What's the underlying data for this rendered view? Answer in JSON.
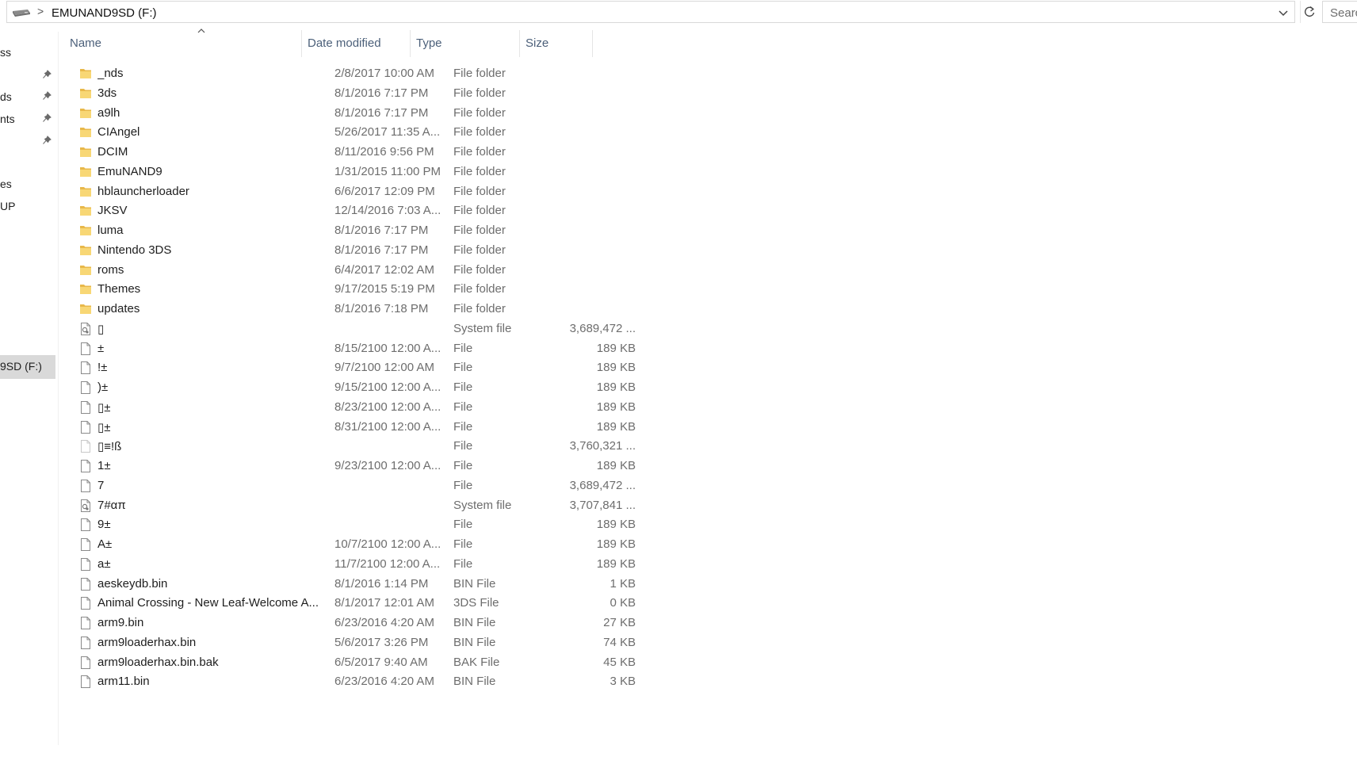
{
  "address_bar": {
    "drive_icon": "drive-icon",
    "separator": ">",
    "location": "EMUNAND9SD (F:)",
    "dropdown_icon": "chevron-down-icon",
    "refresh_icon": "refresh-icon"
  },
  "search": {
    "label": "Search"
  },
  "nav": {
    "items": [
      {
        "label": "ss",
        "pinned": false
      },
      {
        "label": "",
        "pinned": true
      },
      {
        "label": "ds",
        "pinned": true
      },
      {
        "label": "nts",
        "pinned": true
      },
      {
        "label": "",
        "pinned": true
      },
      {
        "label": "es",
        "pinned": false
      },
      {
        "label": "UP",
        "pinned": false
      }
    ],
    "selected": {
      "label": "9SD (F:)"
    }
  },
  "columns": {
    "name": "Name",
    "date_modified": "Date modified",
    "type": "Type",
    "size": "Size",
    "sort_icon": "sort-ascending-icon"
  },
  "files": [
    {
      "name": "_nds",
      "date": "2/8/2017 10:00 AM",
      "type": "File folder",
      "size": "",
      "icon": "folder"
    },
    {
      "name": "3ds",
      "date": "8/1/2016 7:17 PM",
      "type": "File folder",
      "size": "",
      "icon": "folder"
    },
    {
      "name": "a9lh",
      "date": "8/1/2016 7:17 PM",
      "type": "File folder",
      "size": "",
      "icon": "folder"
    },
    {
      "name": "CIAngel",
      "date": "5/26/2017 11:35 A...",
      "type": "File folder",
      "size": "",
      "icon": "folder"
    },
    {
      "name": "DCIM",
      "date": "8/11/2016 9:56 PM",
      "type": "File folder",
      "size": "",
      "icon": "folder"
    },
    {
      "name": "EmuNAND9",
      "date": "1/31/2015 11:00 PM",
      "type": "File folder",
      "size": "",
      "icon": "folder"
    },
    {
      "name": "hblauncherloader",
      "date": "6/6/2017 12:09 PM",
      "type": "File folder",
      "size": "",
      "icon": "folder"
    },
    {
      "name": "JKSV",
      "date": "12/14/2016 7:03 A...",
      "type": "File folder",
      "size": "",
      "icon": "folder"
    },
    {
      "name": "luma",
      "date": "8/1/2016 7:17 PM",
      "type": "File folder",
      "size": "",
      "icon": "folder"
    },
    {
      "name": "Nintendo 3DS",
      "date": "8/1/2016 7:17 PM",
      "type": "File folder",
      "size": "",
      "icon": "folder"
    },
    {
      "name": "roms",
      "date": "6/4/2017 12:02 AM",
      "type": "File folder",
      "size": "",
      "icon": "folder"
    },
    {
      "name": "Themes",
      "date": "9/17/2015 5:19 PM",
      "type": "File folder",
      "size": "",
      "icon": "folder"
    },
    {
      "name": "updates",
      "date": "8/1/2016 7:18 PM",
      "type": "File folder",
      "size": "",
      "icon": "folder"
    },
    {
      "name": "▯",
      "date": "",
      "type": "System file",
      "size": "3,689,472 ...",
      "icon": "system"
    },
    {
      "name": " ±",
      "date": "8/15/2100 12:00 A...",
      "type": "File",
      "size": "189 KB",
      "icon": "file"
    },
    {
      "name": "!±",
      "date": "9/7/2100 12:00 AM",
      "type": "File",
      "size": "189 KB",
      "icon": "file"
    },
    {
      "name": ")±",
      "date": "9/15/2100 12:00 A...",
      "type": "File",
      "size": "189 KB",
      "icon": "file"
    },
    {
      "name": "▯±",
      "date": "8/23/2100 12:00 A...",
      "type": "File",
      "size": "189 KB",
      "icon": "file"
    },
    {
      "name": "▯±",
      "date": "8/31/2100 12:00 A...",
      "type": "File",
      "size": "189 KB",
      "icon": "file"
    },
    {
      "name": "▯≡!ß",
      "date": "",
      "type": "File",
      "size": "3,760,321 ...",
      "icon": "file-faded"
    },
    {
      "name": "1±",
      "date": "9/23/2100 12:00 A...",
      "type": "File",
      "size": "189 KB",
      "icon": "file"
    },
    {
      "name": "7",
      "date": "",
      "type": "File",
      "size": "3,689,472 ...",
      "icon": "file"
    },
    {
      "name": "7#απ",
      "date": "",
      "type": "System file",
      "size": "3,707,841 ...",
      "icon": "system"
    },
    {
      "name": "9±",
      "date": "",
      "type": "File",
      "size": "189 KB",
      "icon": "file"
    },
    {
      "name": "A±",
      "date": "10/7/2100 12:00 A...",
      "type": "File",
      "size": "189 KB",
      "icon": "file"
    },
    {
      "name": "a±",
      "date": "11/7/2100 12:00 A...",
      "type": "File",
      "size": "189 KB",
      "icon": "file"
    },
    {
      "name": "aeskeydb.bin",
      "date": "8/1/2016 1:14 PM",
      "type": "BIN File",
      "size": "1 KB",
      "icon": "file"
    },
    {
      "name": "Animal Crossing - New Leaf-Welcome A...",
      "date": "8/1/2017 12:01 AM",
      "type": "3DS File",
      "size": "0 KB",
      "icon": "file"
    },
    {
      "name": "arm9.bin",
      "date": "6/23/2016 4:20 AM",
      "type": "BIN File",
      "size": "27 KB",
      "icon": "file"
    },
    {
      "name": "arm9loaderhax.bin",
      "date": "5/6/2017 3:26 PM",
      "type": "BIN File",
      "size": "74 KB",
      "icon": "file"
    },
    {
      "name": "arm9loaderhax.bin.bak",
      "date": "6/5/2017 9:40 AM",
      "type": "BAK File",
      "size": "45 KB",
      "icon": "file"
    },
    {
      "name": "arm11.bin",
      "date": "6/23/2016 4:20 AM",
      "type": "BIN File",
      "size": "3 KB",
      "icon": "file"
    }
  ]
}
